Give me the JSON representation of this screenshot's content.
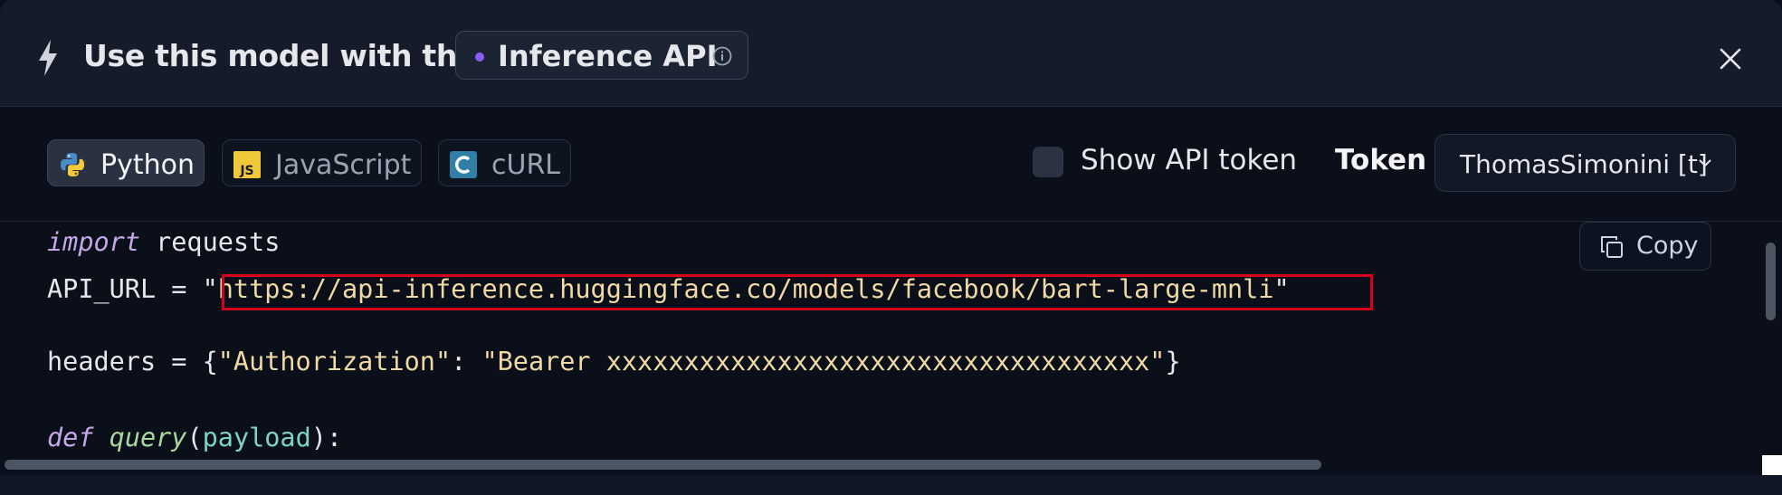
{
  "header": {
    "title": "Use this model with the",
    "api_pill_label": "Inference API",
    "icons": {
      "bolt": "bolt-icon",
      "info": "info-icon",
      "close": "close-icon"
    }
  },
  "toolbar": {
    "tabs": [
      {
        "label": "Python",
        "icon": "python-icon",
        "active": true
      },
      {
        "label": "JavaScript",
        "icon": "javascript-icon",
        "active": false
      },
      {
        "label": "cURL",
        "icon": "curl-icon",
        "active": false
      }
    ],
    "show_token_label": "Show API token",
    "show_token_checked": false,
    "token_label": "Token",
    "token_select_value": "ThomasSimonini [t]"
  },
  "code": {
    "copy_label": "Copy",
    "line1_kw": "import",
    "line1_rest": " requests",
    "line3_pre": "API_URL = \"",
    "line3_url": "https://api-inference.huggingface.co/models/facebook/bart-large-mnli",
    "line3_post": "\"",
    "line4_pre": "headers = {",
    "line4_key": "\"Authorization\"",
    "line4_mid": ": ",
    "line4_val": "\"Bearer xxxxxxxxxxxxxxxxxxxxxxxxxxxxxxxxxxx\"",
    "line4_post": "}",
    "line6_kw": "def",
    "line6_fn": "query",
    "line6_open": "(",
    "line6_param": "payload",
    "line6_close": "):"
  },
  "colors": {
    "accent_dot": "#8b5cf6",
    "highlight_box": "#d6001c",
    "background": "#0b0f19",
    "header_bg": "#151b28"
  }
}
